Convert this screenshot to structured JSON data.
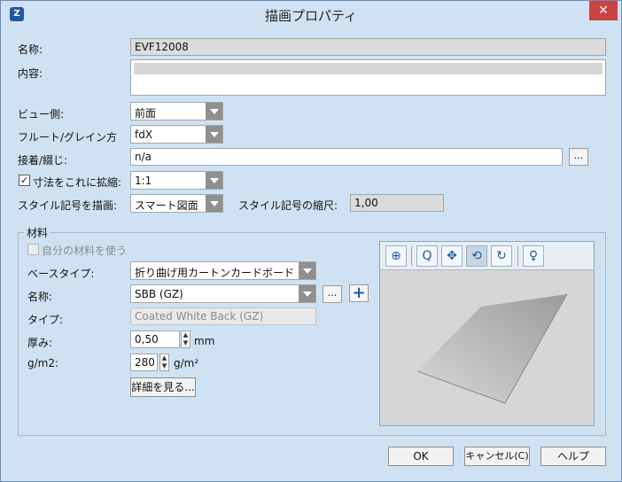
{
  "window": {
    "title": "描画プロパティ",
    "close": "✕"
  },
  "fields": {
    "name_label": "名称:",
    "name_value": "EVF12008",
    "content_label": "内容:",
    "view_label": "ビュー側:",
    "view_value": "前面",
    "flute_label": "フルート/グレイン方",
    "flute_value": "fdX",
    "glue_label": "接着/綴じ:",
    "glue_value": "n/a",
    "glue_btn": "...",
    "scale_label": "寸法をこれに拡縮:",
    "scale_value": "1:1",
    "scale_checked": "✓",
    "style_label": "スタイル記号を描画:",
    "style_value": "スマート図面",
    "style_scale_label": "スタイル記号の縮尺:",
    "style_scale_value": "1,00"
  },
  "material": {
    "group_title": "材料",
    "use_own_label": "自分の材料を使う",
    "base_type_label": "ベースタイプ:",
    "base_type_value": "折り曲げ用カートンカードボード",
    "name_label": "名称:",
    "name_value": "SBB (GZ)",
    "name_btn": "...",
    "add_btn": "+",
    "type_label": "タイプ:",
    "type_value": "Coated White Back (GZ)",
    "thickness_label": "厚み:",
    "thickness_value": "0,50",
    "thickness_unit": "mm",
    "gsm_label": "g/m2:",
    "gsm_value": "280",
    "gsm_unit": "g/m²",
    "details_btn": "詳細を見る..."
  },
  "preview": {
    "tools": [
      {
        "icon": "zoom-fit-icon",
        "glyph": "⊕"
      },
      {
        "icon": "zoom-icon",
        "glyph": "Q"
      },
      {
        "icon": "pan-icon",
        "glyph": "✥"
      },
      {
        "icon": "rotate-icon",
        "glyph": "⟲"
      },
      {
        "icon": "orbit-icon",
        "glyph": "↻"
      },
      {
        "icon": "light-icon",
        "glyph": "♀"
      }
    ]
  },
  "buttons": {
    "ok": "OK",
    "cancel": "キャンセル(C)",
    "help": "ヘルプ"
  },
  "colors": {
    "dialog_bg": "#cfe2f3",
    "close_bg": "#c94343",
    "accent": "#1f5a9e"
  }
}
